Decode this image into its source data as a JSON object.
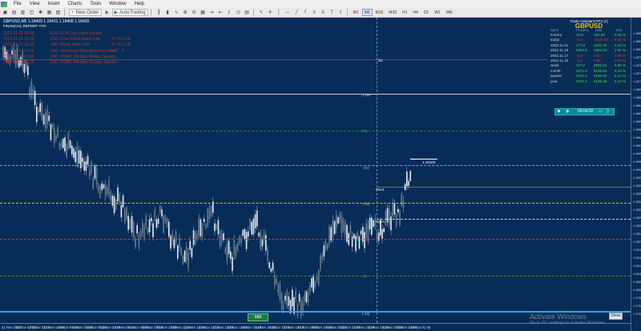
{
  "menu": {
    "items": [
      "File",
      "View",
      "Insert",
      "Charts",
      "Tools",
      "Window",
      "Help"
    ]
  },
  "toolbar": {
    "new_order": "New Order",
    "autotrading": "AutoTrading",
    "timeframes": [
      "M1",
      "M5",
      "M15",
      "M30",
      "H1",
      "H4",
      "D1",
      "W1",
      "MN"
    ],
    "active_timeframe": "M5"
  },
  "chart": {
    "title": "GBPUSD,M5  1.18409  1.18421  1.18408  1.18420",
    "report_title": "FINANCIAL REPORT YTD",
    "news_color": "#b53a2a",
    "news": [
      {
        "time": "2022.11.22 09:50",
        "event": "EUR: ECB Guy Lowe Speaks",
        "v1": "",
        "v2": ""
      },
      {
        "time": "2022.11.22 15:30",
        "event": "CAD: Core Retail Sales m/m",
        "v1": "0.7%",
        "v2": "1.0%"
      },
      {
        "time": "2022.11.22 15:30",
        "event": "CAD: Retail Sales m/m",
        "v1": "0.7%",
        "v2": "1.1%"
      },
      {
        "time": "2022.11.22 17:00",
        "event": "USD: Richmond Manufacturing Index",
        "v1": "-10",
        "v2": "0"
      },
      {
        "time": "2022.11.22 19:00",
        "event": "USD: FOMC Member Mester Speaks",
        "v1": "",
        "v2": ""
      },
      {
        "time": "2022.11.22 21:15",
        "event": "USD: FOMC Member George Speaks",
        "v1": "",
        "v2": ""
      }
    ],
    "levels": {
      "R1": "R1",
      "high": "1.HIP",
      "r_mid": "(70)",
      "p50": "(50)",
      "pivot": "Pivot",
      "p78": "(78)",
      "open": "Open",
      "p30": "(30)",
      "p0": "(0)",
      "low": "(-10)",
      "price_tag": "1.18420"
    },
    "price_scale": [
      "1.18865",
      "1.18840",
      "1.18815",
      "1.18790",
      "1.18765",
      "1.18740",
      "1.18715",
      "1.18690",
      "1.18665",
      "1.18640",
      "1.18615",
      "1.18590",
      "1.18565",
      "1.18540",
      "1.18515",
      "1.18490",
      "1.18465",
      "1.18440",
      "1.18415",
      "1.18390",
      "1.18365",
      "1.18340",
      "1.18315",
      "1.18290",
      "1.18265",
      "1.18240",
      "1.18215",
      "1.18190",
      "1.18165",
      "1.18140",
      "1.18115",
      "1.18090",
      "1.18065",
      "1.17965",
      "1.17940",
      "1.17915"
    ],
    "time_axis": [
      "21 Nov 2022",
      "21 Nov 02:25",
      "21 Nov 03:15",
      "21 Nov 04:05",
      "21 Nov 04:55",
      "21 Nov 05:45",
      "21 Nov 06:35",
      "21 Nov 07:25",
      "21 Nov 08:15",
      "21 Nov 09:05",
      "21 Nov 09:55",
      "21 Nov 10:45",
      "21 Nov 11:35",
      "21 Nov 12:25",
      "21 Nov 13:15",
      "21 Nov 14:05",
      "21 Nov 14:55",
      "21 Nov 15:45",
      "21 Nov 16:35",
      "21 Nov 17:25",
      "21 Nov 18:15",
      "21 Nov 19:05",
      "21 Nov 19:55",
      "21 Nov 20:45",
      "21 Nov 21:35",
      "21 Nov 22:25",
      "21 Nov 23:15",
      "22 Nov 00:05",
      "22 Nov 00:55",
      "22 Nov 01:45"
    ],
    "mm_button": "MM",
    "show_button": "Show"
  },
  "trade_assistant": {
    "title": "Trade Assistant MT4 (c)",
    "symbol": "GBPUSD",
    "headers": [
      "DATE",
      "POINTS",
      "USD",
      "ROI"
    ],
    "rows": [
      {
        "date": "current",
        "points": "10.9",
        "usd": "163.58",
        "roi": "0.16 %",
        "neg": false
      },
      {
        "date": "today",
        "points": "-0.0",
        "usd": "-3320.43",
        "roi": "0.00 %",
        "neg": true
      },
      {
        "date": "2022.11.21",
        "points": "177.5",
        "usd": "4220.36",
        "roi": "4.22 %",
        "neg": false
      },
      {
        "date": "2022.11.18",
        "points": "3253.8",
        "usd": "2964.64",
        "roi": "2.91 %",
        "neg": false
      },
      {
        "date": "2022.11.17",
        "points": "-2.0",
        "usd": "0.00",
        "roi": "0.00 %",
        "neg": true
      },
      {
        "date": "2022.11.16",
        "points": "-0.0",
        "usd": "0.00",
        "roi": "0.00 %",
        "neg": true
      },
      {
        "date": "week",
        "points": "117.2",
        "usd": "3882.04",
        "roi": "3.88 %",
        "neg": false
      },
      {
        "date": "month",
        "points": "3371.0",
        "usd": "5136.60",
        "roi": "5.14 %",
        "neg": false
      },
      {
        "date": "quarter",
        "points": "3371.0",
        "usd": "5136.60",
        "roi": "5.14 %",
        "neg": false
      },
      {
        "date": "year",
        "points": "3371.0",
        "usd": "5136.60",
        "roi": "5.14 %",
        "neg": false
      }
    ],
    "pos_color": "#3ee04a",
    "neg_color": "#e23a2a"
  },
  "timer": {
    "value": "00:04:32"
  },
  "watermark": {
    "line1": "Activate Windows",
    "line2": "Go to PC settings to activate Windows."
  }
}
